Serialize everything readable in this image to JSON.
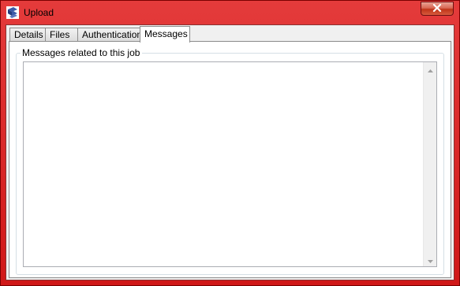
{
  "window": {
    "title": "Upload",
    "close_icon": "close-icon",
    "app_icon": "upload-app-icon"
  },
  "tabs": [
    {
      "label": "Details",
      "active": false
    },
    {
      "label": "Files",
      "active": false
    },
    {
      "label": "Authentication",
      "active": false
    },
    {
      "label": "Messages",
      "active": true
    }
  ],
  "messages_panel": {
    "group_label": "Messages related to this job",
    "messages_text": ""
  },
  "colors": {
    "frame": "#d01818",
    "client_bg": "#f0f0f0",
    "panel_bg": "#ffffff"
  }
}
